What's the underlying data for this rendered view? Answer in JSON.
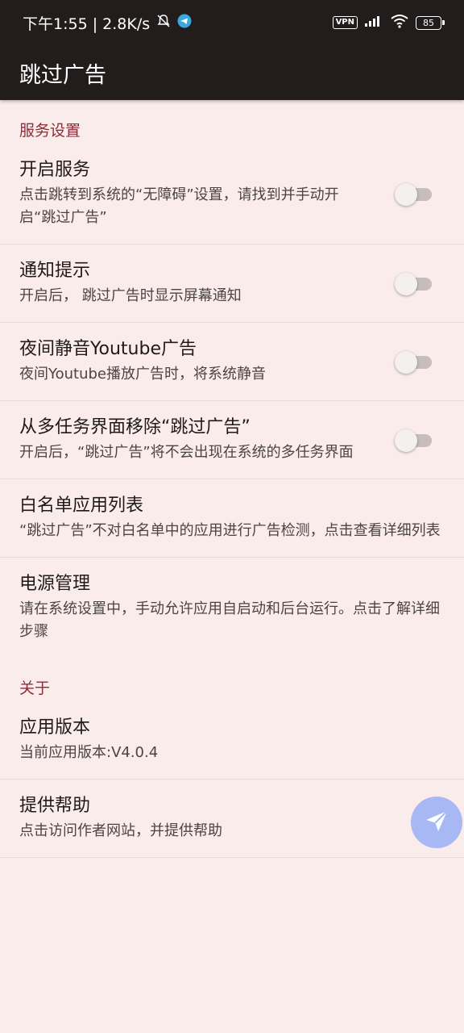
{
  "status_bar": {
    "left_text": "下午1:55 | 2.8K/s",
    "vpn": "VPN",
    "battery": "85"
  },
  "app_bar": {
    "title": "跳过广告"
  },
  "sections": {
    "service": {
      "header": "服务设置",
      "items": [
        {
          "title": "开启服务",
          "summary": "点击跳转到系统的“无障碍”设置，请找到并手动开启“跳过广告”",
          "switch_on": false
        },
        {
          "title": "通知提示",
          "summary": "开启后， 跳过广告时显示屏幕通知",
          "switch_on": false
        },
        {
          "title": "夜间静音Youtube广告",
          "summary": "夜间Youtube播放广告时，将系统静音",
          "switch_on": false
        },
        {
          "title": "从多任务界面移除“跳过广告”",
          "summary": "开启后，“跳过广告”将不会出现在系统的多任务界面",
          "switch_on": false
        },
        {
          "title": "白名单应用列表",
          "summary": "“跳过广告”不对白名单中的应用进行广告检测，点击查看详细列表"
        },
        {
          "title": "电源管理",
          "summary": "请在系统设置中，手动允许应用自启动和后台运行。点击了解详细步骤"
        }
      ]
    },
    "about": {
      "header": "关于",
      "items": [
        {
          "title": "应用版本",
          "summary": "当前应用版本:V4.0.4"
        },
        {
          "title": "提供帮助",
          "summary": "点击访问作者网站，并提供帮助"
        }
      ]
    }
  },
  "fab": {
    "icon": "send-icon"
  }
}
